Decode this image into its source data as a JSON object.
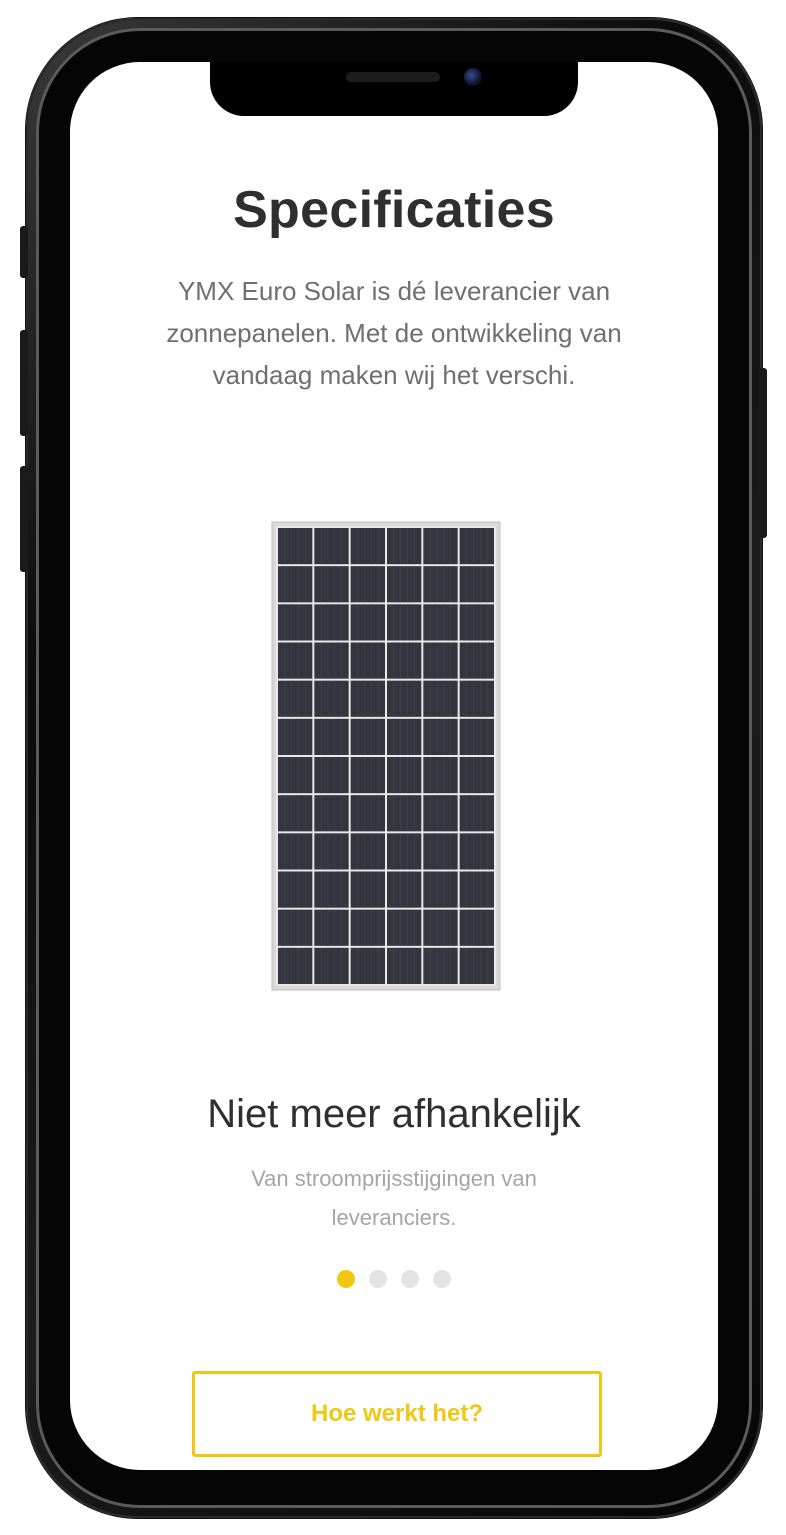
{
  "device": {
    "type": "smartphone-mockup"
  },
  "header": {
    "title": "Specificaties",
    "intro": "YMX Euro Solar is dé leverancier van zonnepanelen. Met de ontwikkeling van vandaag maken wij het verschi."
  },
  "product_image": {
    "icon": "solar-panel-image",
    "colors": {
      "cells": "#2b2d38",
      "frame": "#d8d8d8"
    }
  },
  "slide": {
    "title": "Niet meer afhankelijk",
    "text": "Van stroomprijsstijgingen van leveranciers."
  },
  "carousel": {
    "total": 4,
    "active_index": 0,
    "colors": {
      "active": "#f0c814",
      "inactive": "#e3e3e3"
    }
  },
  "cta": {
    "label": "Hoe werkt het?",
    "color": "#f0c814"
  }
}
